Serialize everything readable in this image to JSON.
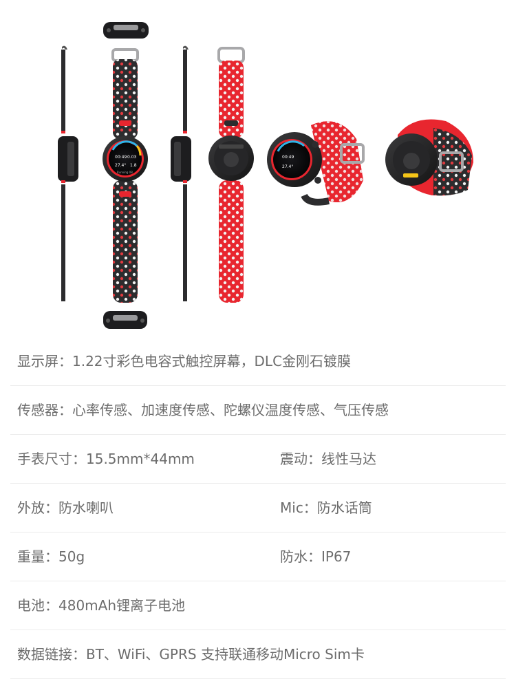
{
  "specs": [
    {
      "items": [
        "显示屏：1.22寸彩色电容式触控屏幕，DLC金刚石镀膜"
      ]
    },
    {
      "items": [
        "传感器：心率传感、加速度传感、陀螺仪温度传感、气压传感"
      ]
    },
    {
      "items": [
        "手表尺寸：15.5mm*44mm",
        "震动：线性马达"
      ]
    },
    {
      "items": [
        "外放：防水喇叭",
        "Mic：防水话筒"
      ]
    },
    {
      "items": [
        "重量：50g",
        "防水：IP67"
      ]
    },
    {
      "items": [
        "电池：480mAh锂离子电池"
      ]
    },
    {
      "items": [
        "数据链接：BT、WiFi、GPRS 支持联通移动Micro Sim卡"
      ]
    }
  ],
  "watch_face": {
    "time_left": "00:49",
    "time_right": "0.03",
    "temp": "27.4°",
    "value": "1.8",
    "footer": "Running 08"
  },
  "colors": {
    "band_black": "#2c2c2e",
    "band_red": "#e8262f",
    "hole_white": "#f2f2f2",
    "hole_red": "#e23a3f",
    "case": "#1d1d1f",
    "text": "#6c6c6c",
    "divider": "#ececec"
  }
}
